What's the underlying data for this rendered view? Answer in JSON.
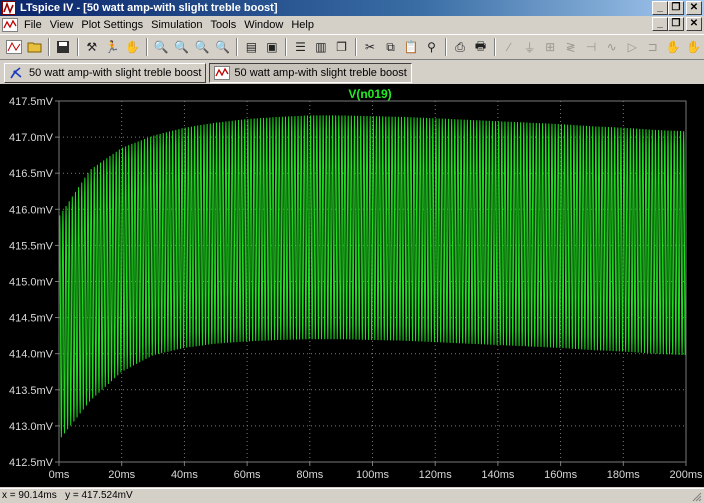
{
  "window": {
    "title": "LTspice IV - [50 watt amp-with slight treble boost]"
  },
  "menu": {
    "items": [
      "File",
      "View",
      "Plot Settings",
      "Simulation",
      "Tools",
      "Window",
      "Help"
    ]
  },
  "tabs": [
    {
      "label": "50 watt amp-with slight treble boost",
      "icon": "schematic-icon",
      "active": false
    },
    {
      "label": "50 watt amp-with slight treble boost",
      "icon": "waveform-icon",
      "active": true
    }
  ],
  "plot": {
    "trace_label": "V(n019)",
    "trace_color": "#22dd22",
    "label_color": "#22ee22",
    "grid_color": "#7a7a7a",
    "axis_text_color": "#d8d8d8",
    "background": "#000000"
  },
  "chart_data": {
    "type": "line",
    "title": "V(n019)",
    "xlabel": "",
    "ylabel": "",
    "x_ticks": [
      "0ms",
      "20ms",
      "40ms",
      "60ms",
      "80ms",
      "100ms",
      "120ms",
      "140ms",
      "160ms",
      "180ms",
      "200ms"
    ],
    "y_ticks": [
      "412.5mV",
      "413.0mV",
      "413.5mV",
      "414.0mV",
      "414.5mV",
      "415.0mV",
      "415.5mV",
      "416.0mV",
      "416.5mV",
      "417.0mV",
      "417.5mV"
    ],
    "xlim": [
      0,
      200
    ],
    "ylim": [
      412.5,
      417.5
    ],
    "grid": true,
    "series": [
      {
        "name": "V(n019)",
        "envelope_upper": {
          "x": [
            0,
            10,
            20,
            30,
            40,
            50,
            60,
            70,
            80,
            90,
            100,
            110,
            120,
            130,
            140,
            150,
            160,
            170,
            180,
            190,
            200
          ],
          "y": [
            415.9,
            416.55,
            416.85,
            417.02,
            417.13,
            417.2,
            417.25,
            417.28,
            417.3,
            417.3,
            417.29,
            417.28,
            417.26,
            417.24,
            417.22,
            417.2,
            417.18,
            417.15,
            417.13,
            417.1,
            417.08
          ]
        },
        "envelope_lower": {
          "x": [
            0,
            10,
            20,
            30,
            40,
            50,
            60,
            70,
            80,
            90,
            100,
            110,
            120,
            130,
            140,
            150,
            160,
            170,
            180,
            190,
            200
          ],
          "y": [
            412.8,
            413.35,
            413.75,
            413.98,
            414.08,
            414.14,
            414.17,
            414.19,
            414.2,
            414.2,
            414.19,
            414.18,
            414.16,
            414.14,
            414.12,
            414.1,
            414.08,
            414.05,
            414.03,
            414.0,
            413.98
          ]
        }
      }
    ]
  },
  "status": {
    "text": "x = 90.14ms   y = 417.524mV"
  }
}
